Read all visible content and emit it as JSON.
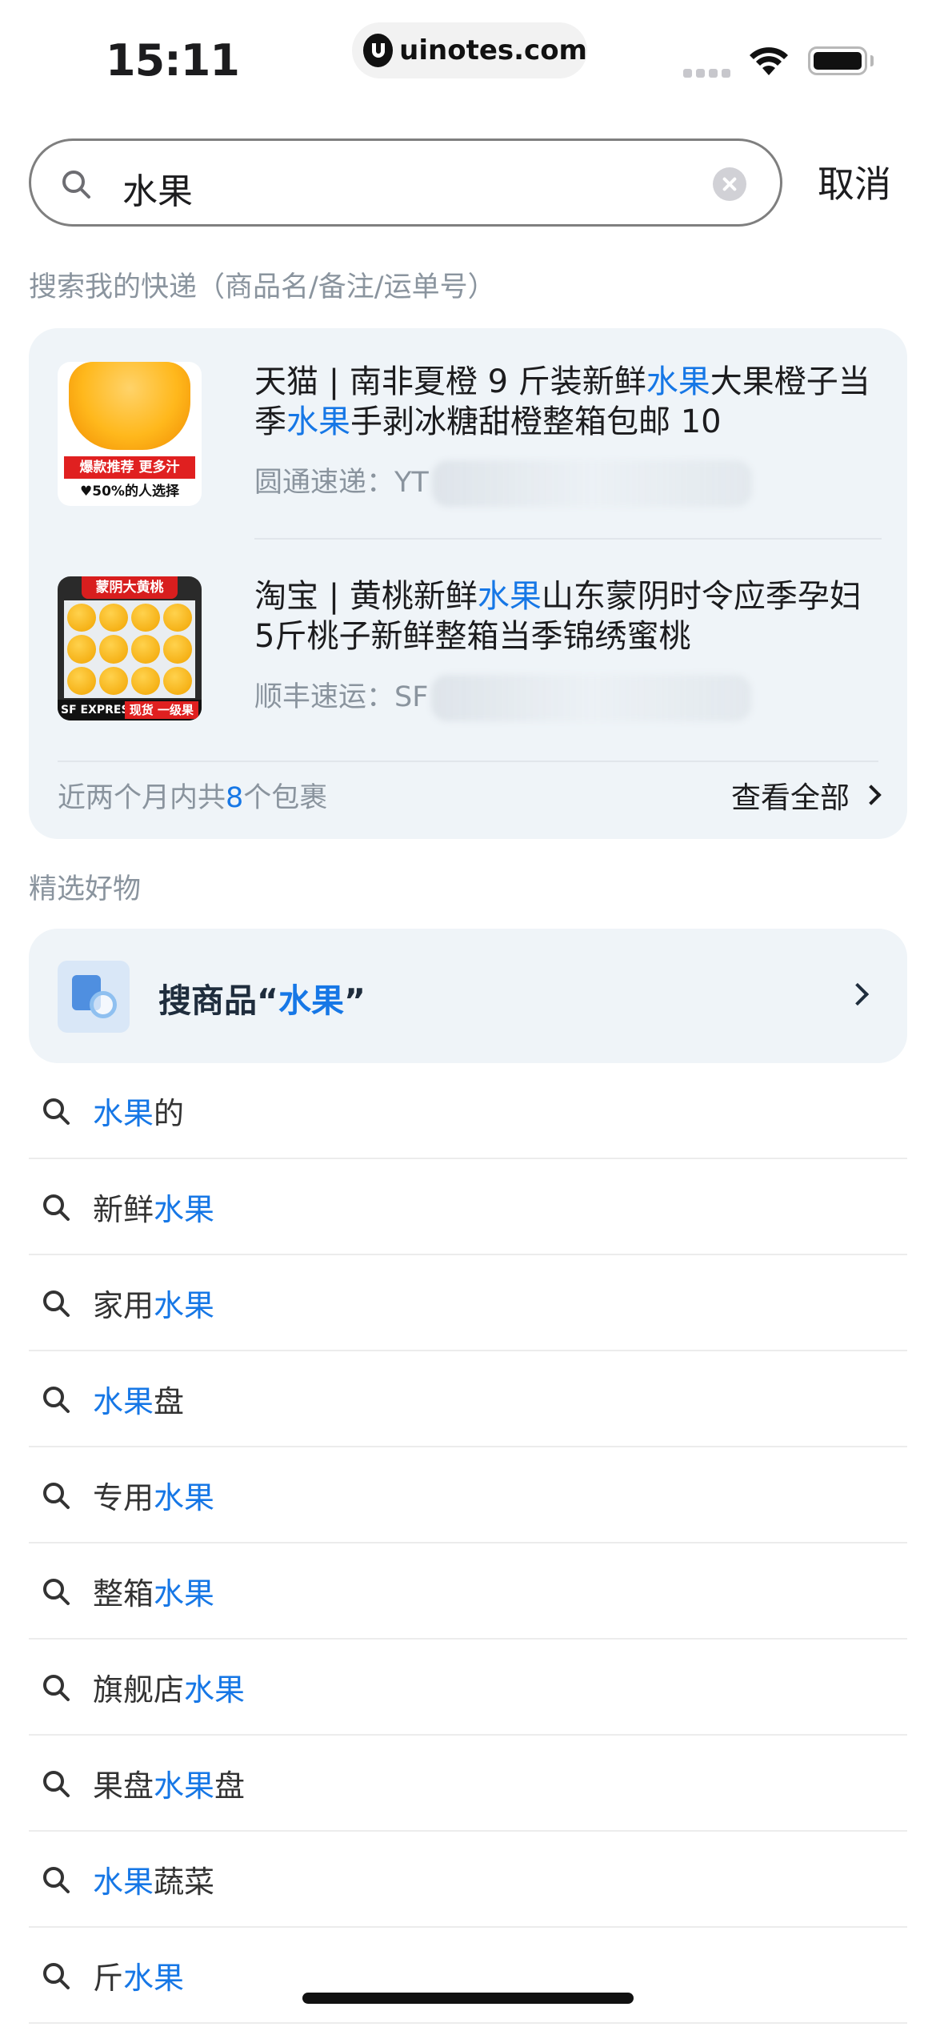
{
  "status_bar": {
    "time": "15:11",
    "watermark": "uinotes.com"
  },
  "search": {
    "query": "水果",
    "cancel_label": "取消"
  },
  "express": {
    "section_title": "搜索我的快递（商品名/备注/运单号）",
    "packages": [
      {
        "title_parts": [
          "天猫 | 南非夏橙 9 斤装新鲜",
          "水果",
          "大果橙子当季",
          "水果",
          "手剥冰糖甜橙整箱包邮 10"
        ],
        "carrier": "圆通速递：YT",
        "thumb_tag_1": "爆款推荐 更多汁",
        "thumb_tag_2": "♥50%的人选择"
      },
      {
        "title_parts": [
          "淘宝 | 黄桃新鲜",
          "水果",
          "山东蒙阴时令应季孕妇5斤桃子新鲜整箱当季锦绣蜜桃"
        ],
        "carrier": "顺丰速运：SF",
        "thumb_banner": "蒙阴大黄桃",
        "thumb_sf": "SF EXPRESS",
        "thumb_bottom_tag": "现货 一级果"
      }
    ],
    "summary_prefix": "近两个月内共",
    "summary_count": "8",
    "summary_suffix": "个包裹",
    "view_all_label": "查看全部"
  },
  "goods": {
    "section_title": "精选好物",
    "label_prefix": "搜商品“",
    "label_keyword": "水果",
    "label_suffix": "”"
  },
  "suggestions": [
    {
      "before": "",
      "keyword": "水果",
      "after": "的"
    },
    {
      "before": "新鲜",
      "keyword": "水果",
      "after": ""
    },
    {
      "before": "家用",
      "keyword": "水果",
      "after": ""
    },
    {
      "before": "",
      "keyword": "水果",
      "after": "盘"
    },
    {
      "before": "专用",
      "keyword": "水果",
      "after": ""
    },
    {
      "before": "整箱",
      "keyword": "水果",
      "after": ""
    },
    {
      "before": "旗舰店",
      "keyword": "水果",
      "after": ""
    },
    {
      "before": "果盘",
      "keyword": "水果",
      "after": "盘"
    },
    {
      "before": "",
      "keyword": "水果",
      "after": "蔬菜"
    },
    {
      "before": "斤",
      "keyword": "水果",
      "after": ""
    }
  ],
  "colors": {
    "highlight": "#1677e6",
    "card_bg": "#eff4f8",
    "muted_text": "#8a949e"
  }
}
